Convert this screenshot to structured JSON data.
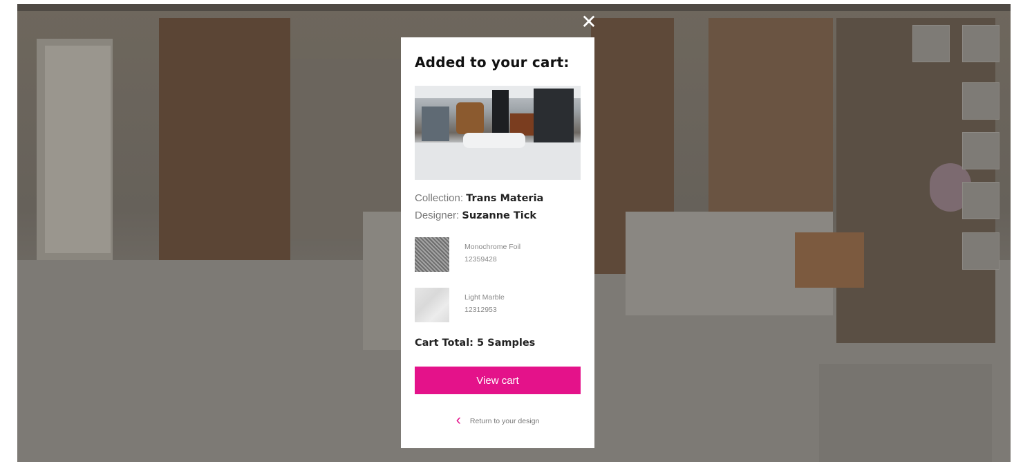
{
  "modal": {
    "title": "Added to your cart:",
    "close_icon": "close-icon",
    "collection_label": "Collection:",
    "collection_value": "Trans Materia",
    "designer_label": "Designer:",
    "designer_value": "Suzanne Tick",
    "samples": [
      {
        "name": "Monochrome Foil",
        "code": "12359428"
      },
      {
        "name": "Light Marble",
        "code": "12312953"
      }
    ],
    "cart_total": "Cart Total: 5 Samples",
    "view_cart_label": "View cart",
    "return_label": "Return to your design",
    "return_icon": "chevron-left-icon",
    "accent_color": "#e4128a"
  }
}
